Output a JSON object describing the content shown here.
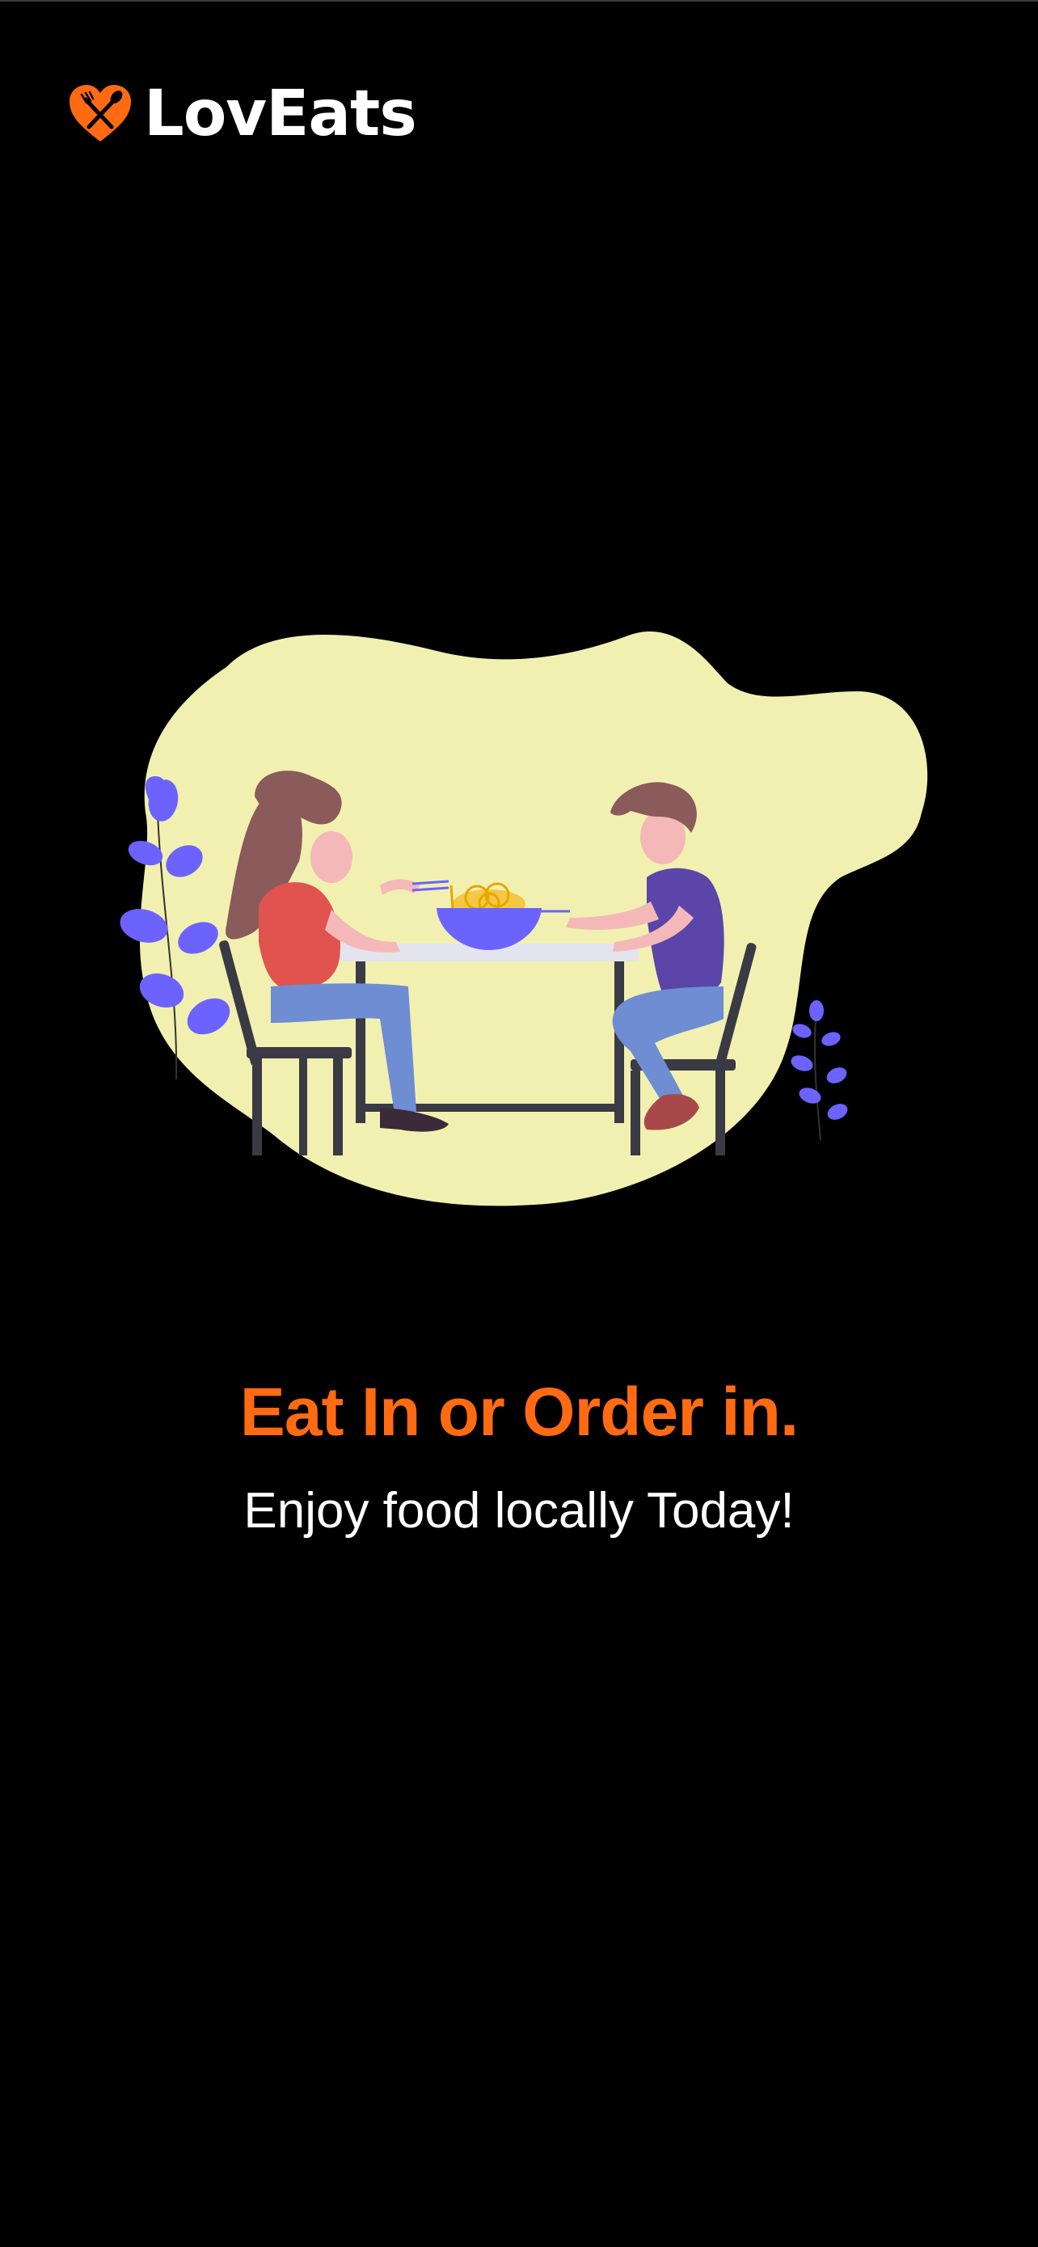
{
  "brand": {
    "name": "LovEats",
    "icon": "heart-fork-knife-icon",
    "accent_color": "#ff6a12"
  },
  "hero": {
    "illustration": "couple-dining-illustration",
    "blob_color": "#f1f0b0",
    "leaf_color": "#6c63ff"
  },
  "main": {
    "headline": "Eat In or Order in.",
    "subheadline": "Enjoy food locally Today!",
    "headline_color": "#ff6a12",
    "subheadline_color": "#ffffff"
  }
}
